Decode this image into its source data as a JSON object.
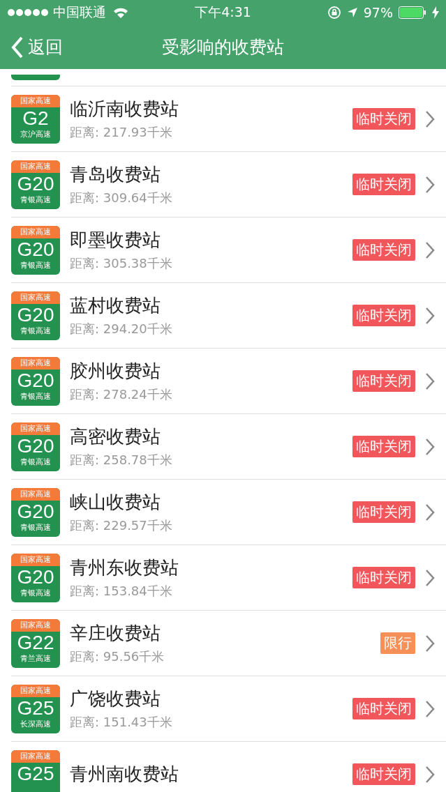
{
  "status_bar": {
    "carrier": "中国联通",
    "time": "下午4:31",
    "battery": "97%"
  },
  "nav": {
    "back": "返回",
    "title": "受影响的收费站"
  },
  "stations": [
    {
      "network": "国家高速",
      "code": "G2",
      "road": "京沪高速",
      "name": "临沂南收费站",
      "distance": "距离: 217.93千米",
      "status": "临时关闭",
      "kind": "closed"
    },
    {
      "network": "国家高速",
      "code": "G20",
      "road": "青银高速",
      "name": "青岛收费站",
      "distance": "距离: 309.64千米",
      "status": "临时关闭",
      "kind": "closed"
    },
    {
      "network": "国家高速",
      "code": "G20",
      "road": "青银高速",
      "name": "即墨收费站",
      "distance": "距离: 305.38千米",
      "status": "临时关闭",
      "kind": "closed"
    },
    {
      "network": "国家高速",
      "code": "G20",
      "road": "青银高速",
      "name": "蓝村收费站",
      "distance": "距离: 294.20千米",
      "status": "临时关闭",
      "kind": "closed"
    },
    {
      "network": "国家高速",
      "code": "G20",
      "road": "青银高速",
      "name": "胶州收费站",
      "distance": "距离: 278.24千米",
      "status": "临时关闭",
      "kind": "closed"
    },
    {
      "network": "国家高速",
      "code": "G20",
      "road": "青银高速",
      "name": "高密收费站",
      "distance": "距离: 258.78千米",
      "status": "临时关闭",
      "kind": "closed"
    },
    {
      "network": "国家高速",
      "code": "G20",
      "road": "青银高速",
      "name": "峡山收费站",
      "distance": "距离: 229.57千米",
      "status": "临时关闭",
      "kind": "closed"
    },
    {
      "network": "国家高速",
      "code": "G20",
      "road": "青银高速",
      "name": "青州东收费站",
      "distance": "距离: 153.84千米",
      "status": "临时关闭",
      "kind": "closed"
    },
    {
      "network": "国家高速",
      "code": "G22",
      "road": "青兰高速",
      "name": "辛庄收费站",
      "distance": "距离: 95.56千米",
      "status": "限行",
      "kind": "restricted"
    },
    {
      "network": "国家高速",
      "code": "G25",
      "road": "长深高速",
      "name": "广饶收费站",
      "distance": "距离: 151.43千米",
      "status": "临时关闭",
      "kind": "closed"
    },
    {
      "network": "国家高速",
      "code": "G25",
      "name": "青州南收费站",
      "status": "临时关闭",
      "kind": "closed"
    }
  ]
}
